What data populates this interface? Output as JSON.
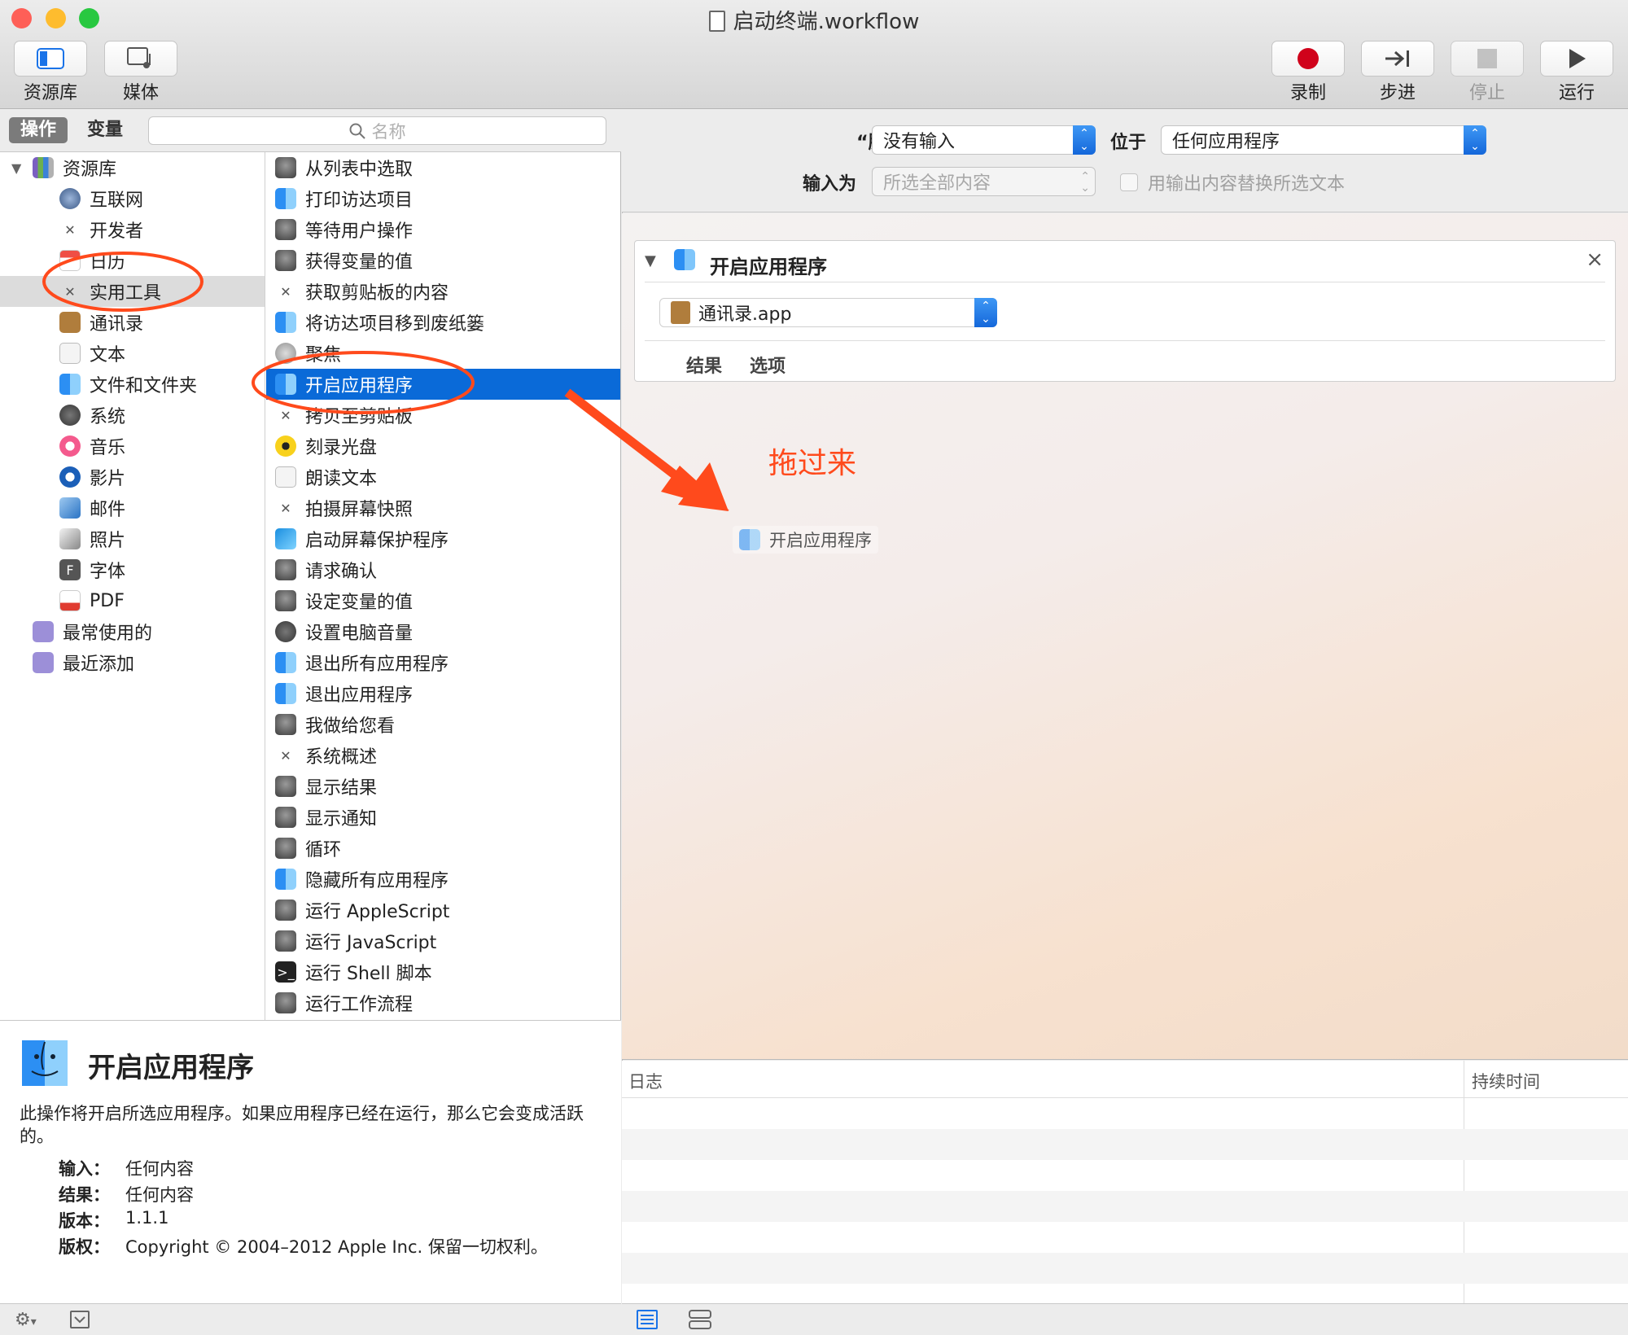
{
  "window": {
    "title": "启动终端.workflow"
  },
  "toolbar": {
    "left": [
      {
        "label": "资源库",
        "icon": "library-icon"
      },
      {
        "label": "媒体",
        "icon": "media-icon"
      }
    ],
    "right": [
      {
        "label": "录制",
        "icon": "record-icon"
      },
      {
        "label": "步进",
        "icon": "step-icon"
      },
      {
        "label": "停止",
        "icon": "stop-icon"
      },
      {
        "label": "运行",
        "icon": "run-icon"
      }
    ]
  },
  "tabs": {
    "actions": "操作",
    "variables": "变量"
  },
  "search": {
    "placeholder": "名称"
  },
  "library": [
    {
      "label": "资源库",
      "icon": "library-books-icon"
    },
    {
      "label": "互联网",
      "icon": "globe-icon"
    },
    {
      "label": "开发者",
      "icon": "tools-icon"
    },
    {
      "label": "日历",
      "icon": "calendar-icon"
    },
    {
      "label": "实用工具",
      "icon": "utilities-icon"
    },
    {
      "label": "通讯录",
      "icon": "contacts-icon"
    },
    {
      "label": "文本",
      "icon": "text-icon"
    },
    {
      "label": "文件和文件夹",
      "icon": "finder-icon"
    },
    {
      "label": "系统",
      "icon": "system-icon"
    },
    {
      "label": "音乐",
      "icon": "music-icon"
    },
    {
      "label": "影片",
      "icon": "quicktime-icon"
    },
    {
      "label": "邮件",
      "icon": "mail-icon"
    },
    {
      "label": "照片",
      "icon": "photos-icon"
    },
    {
      "label": "字体",
      "icon": "font-icon"
    },
    {
      "label": "PDF",
      "icon": "pdf-icon"
    },
    {
      "label": "最常使用的",
      "icon": "smart-folder-icon"
    },
    {
      "label": "最近添加",
      "icon": "smart-folder-icon"
    }
  ],
  "actions": [
    {
      "label": "从列表中选取",
      "icon": "automator-icon"
    },
    {
      "label": "打印访达项目",
      "icon": "finder-icon"
    },
    {
      "label": "等待用户操作",
      "icon": "automator-icon"
    },
    {
      "label": "获得变量的值",
      "icon": "automator-icon"
    },
    {
      "label": "获取剪贴板的内容",
      "icon": "tools-icon"
    },
    {
      "label": "将访达项目移到废纸篓",
      "icon": "finder-icon"
    },
    {
      "label": "聚焦",
      "icon": "spotlight-icon"
    },
    {
      "label": "开启应用程序",
      "icon": "finder-icon"
    },
    {
      "label": "拷贝至剪贴板",
      "icon": "tools-icon"
    },
    {
      "label": "刻录光盘",
      "icon": "burn-icon"
    },
    {
      "label": "朗读文本",
      "icon": "text-icon"
    },
    {
      "label": "拍摄屏幕快照",
      "icon": "tools-icon"
    },
    {
      "label": "启动屏幕保护程序",
      "icon": "screensaver-icon"
    },
    {
      "label": "请求确认",
      "icon": "automator-icon"
    },
    {
      "label": "设定变量的值",
      "icon": "automator-icon"
    },
    {
      "label": "设置电脑音量",
      "icon": "system-icon"
    },
    {
      "label": "退出所有应用程序",
      "icon": "finder-icon"
    },
    {
      "label": "退出应用程序",
      "icon": "finder-icon"
    },
    {
      "label": "我做给您看",
      "icon": "automator-icon"
    },
    {
      "label": "系统概述",
      "icon": "tools-icon"
    },
    {
      "label": "显示结果",
      "icon": "automator-icon"
    },
    {
      "label": "显示通知",
      "icon": "automator-icon"
    },
    {
      "label": "循环",
      "icon": "automator-icon"
    },
    {
      "label": "隐藏所有应用程序",
      "icon": "finder-icon"
    },
    {
      "label": "运行 AppleScript",
      "icon": "automator-icon"
    },
    {
      "label": "运行 JavaScript",
      "icon": "automator-icon"
    },
    {
      "label": "运行 Shell 脚本",
      "icon": "terminal-icon"
    },
    {
      "label": "运行工作流程",
      "icon": "automator-icon"
    }
  ],
  "info": {
    "title": "开启应用程序",
    "description": "此操作将开启所选应用程序。如果应用程序已经在运行，那么它会变成活跃的。",
    "fields": [
      {
        "key": "输入：",
        "value": "任何内容"
      },
      {
        "key": "结果：",
        "value": "任何内容"
      },
      {
        "key": "版本：",
        "value": "1.1.1"
      },
      {
        "key": "版权：",
        "value": "Copyright © 2004–2012 Apple Inc. 保留一切权利。"
      }
    ]
  },
  "service": {
    "receives_label": "“服务”收到",
    "receives_value": "没有输入",
    "in_label": "位于",
    "in_value": "任何应用程序",
    "input_is_label": "输入为",
    "input_is_value": "所选全部内容",
    "replace_label": "用输出内容替换所选文本",
    "replace_checked": false
  },
  "card": {
    "title": "开启应用程序",
    "app_value": "通讯录.app",
    "tab_results": "结果",
    "tab_options": "选项"
  },
  "annotation": {
    "text": "拖过来",
    "color": "#ff4a1c"
  },
  "drag_ghost": {
    "label": "开启应用程序"
  },
  "log": {
    "col_log": "日志",
    "col_duration": "持续时间"
  },
  "colors": {
    "selection": "#0a6ad8",
    "annotation": "#ff4a1c",
    "close": "#fe5f57",
    "minimize": "#febc2e",
    "zoom": "#28c840"
  }
}
